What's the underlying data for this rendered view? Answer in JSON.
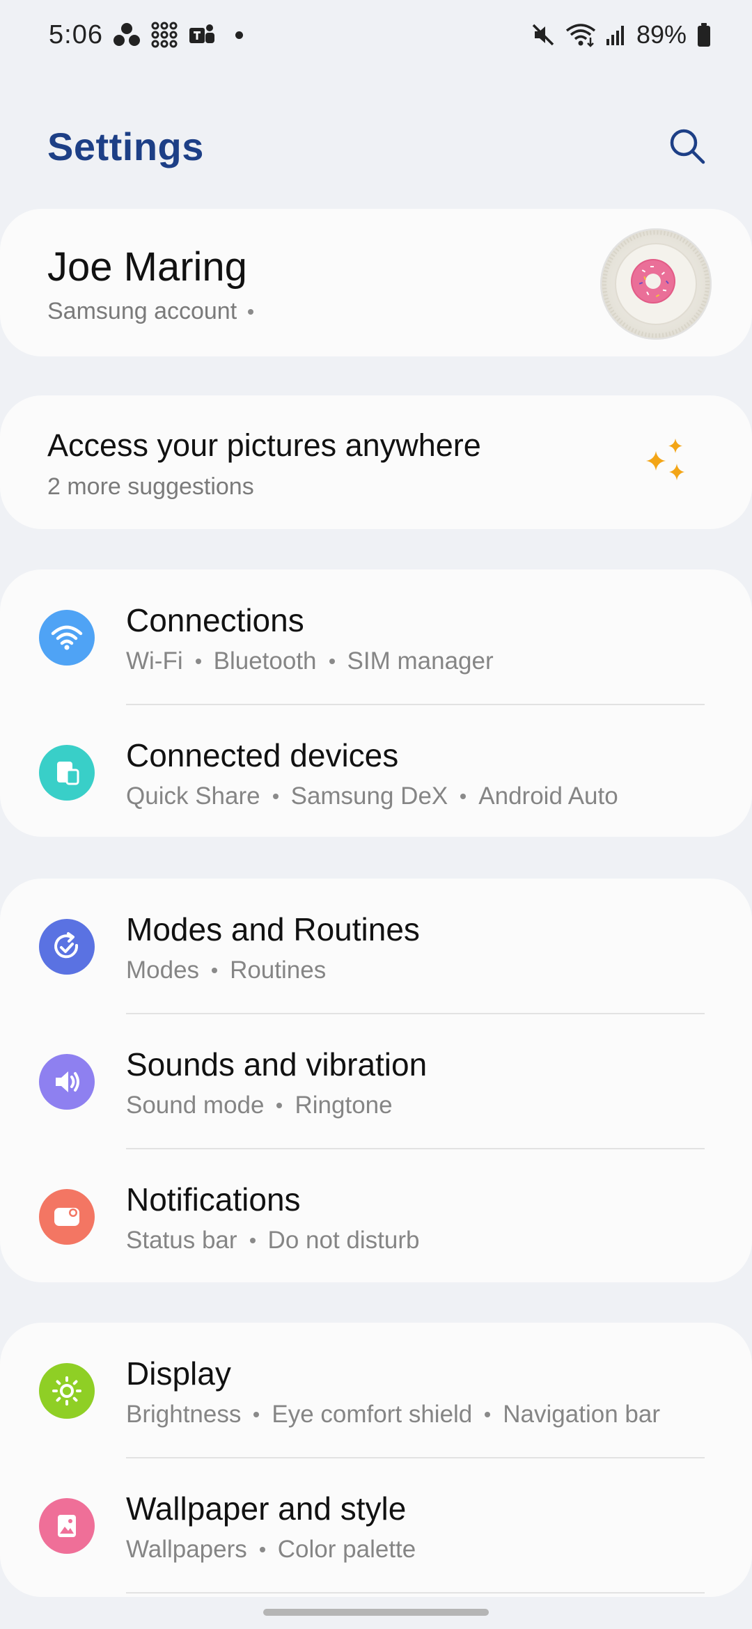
{
  "status_bar": {
    "time": "5:06",
    "battery": "89%",
    "icons": [
      "app-cluster-icon",
      "grid-app-icon",
      "teams-icon",
      "notification-dot",
      "mute-icon",
      "wifi-icon",
      "signal-icon",
      "battery-icon"
    ]
  },
  "header": {
    "title": "Settings",
    "search_icon": "search-icon"
  },
  "account": {
    "name": "Joe Maring",
    "subtitle": "Samsung account"
  },
  "suggestion": {
    "title": "Access your pictures anywhere",
    "subtitle": "2 more suggestions",
    "icon": "sparkle-icon"
  },
  "groups": [
    {
      "items": [
        {
          "title": "Connections",
          "subs": [
            "Wi-Fi",
            "Bluetooth",
            "SIM manager"
          ],
          "icon": "wifi-icon",
          "color": "#4fa3f5"
        },
        {
          "title": "Connected devices",
          "subs": [
            "Quick Share",
            "Samsung DeX",
            "Android Auto"
          ],
          "icon": "devices-icon",
          "color": "#39cfc8"
        }
      ]
    },
    {
      "items": [
        {
          "title": "Modes and Routines",
          "subs": [
            "Modes",
            "Routines"
          ],
          "icon": "routines-icon",
          "color": "#5a72e2"
        },
        {
          "title": "Sounds and vibration",
          "subs": [
            "Sound mode",
            "Ringtone"
          ],
          "icon": "speaker-icon",
          "color": "#8e80f0"
        },
        {
          "title": "Notifications",
          "subs": [
            "Status bar",
            "Do not disturb"
          ],
          "icon": "notification-icon",
          "color": "#f37663"
        }
      ]
    },
    {
      "items": [
        {
          "title": "Display",
          "subs": [
            "Brightness",
            "Eye comfort shield",
            "Navigation bar"
          ],
          "icon": "sun-icon",
          "color": "#8fcf25"
        },
        {
          "title": "Wallpaper and style",
          "subs": [
            "Wallpapers",
            "Color palette"
          ],
          "icon": "wallpaper-icon",
          "color": "#ef6f98"
        }
      ]
    }
  ],
  "colors": {
    "background": "#eff1f5",
    "title_blue": "#1d3f86",
    "sparkle": "#f3a516"
  }
}
